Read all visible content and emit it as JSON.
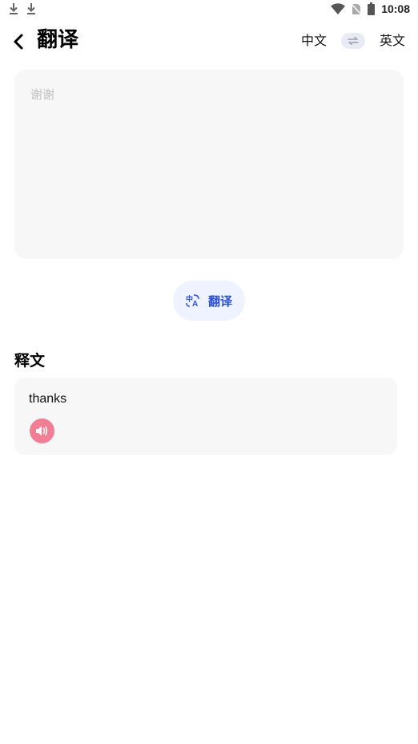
{
  "status_bar": {
    "time": "10:08",
    "left_icons": [
      "download-icon",
      "download-icon"
    ],
    "right_icons": [
      "wifi-icon",
      "no-sim-icon",
      "battery-icon"
    ]
  },
  "header": {
    "title": "翻译",
    "source_lang": "中文",
    "target_lang": "英文"
  },
  "input": {
    "placeholder": "谢谢",
    "value": ""
  },
  "translate_button": {
    "label": "翻译",
    "icon": "translate-icon"
  },
  "result": {
    "title": "释文",
    "text": "thanks",
    "speak_icon": "speaker-icon"
  },
  "colors": {
    "accent_blue": "#2b4fd8",
    "button_bg": "#eef3ff",
    "card_bg": "#f7f7f7",
    "speaker_pink": "#f07f95"
  }
}
